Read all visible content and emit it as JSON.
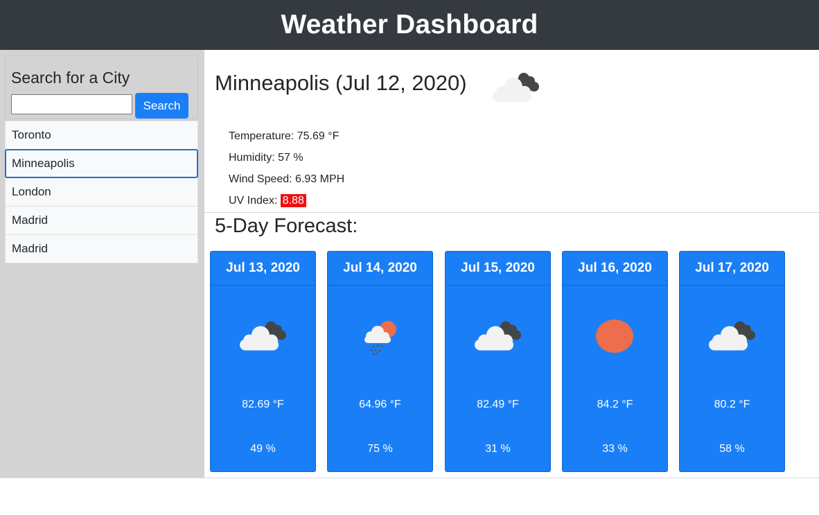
{
  "header": {
    "title": "Weather Dashboard"
  },
  "search": {
    "title": "Search for a City",
    "input_value": "",
    "button_label": "Search"
  },
  "cities": [
    "Toronto",
    "Minneapolis",
    "London",
    "Madrid",
    "Madrid"
  ],
  "current": {
    "title": "Minneapolis (Jul 12, 2020)",
    "icon": "cloudy-icon",
    "temperature": "Temperature: 75.69 °F",
    "humidity": "Humidity: 57 %",
    "wind": "Wind Speed: 6.93 MPH",
    "uv_label": "UV Index: ",
    "uv_value": "8.88",
    "uv_color": "#ee1111"
  },
  "forecast": {
    "title": "5-Day Forecast:",
    "days": [
      {
        "date": "Jul 13, 2020",
        "icon": "cloudy-icon",
        "temp": "82.69 °F",
        "humidity": "49 %"
      },
      {
        "date": "Jul 14, 2020",
        "icon": "rain-sun-icon",
        "temp": "64.96 °F",
        "humidity": "75 %"
      },
      {
        "date": "Jul 15, 2020",
        "icon": "cloudy-icon",
        "temp": "82.49 °F",
        "humidity": "31 %"
      },
      {
        "date": "Jul 16, 2020",
        "icon": "sun-icon",
        "temp": "84.2 °F",
        "humidity": "33 %"
      },
      {
        "date": "Jul 17, 2020",
        "icon": "cloudy-icon",
        "temp": "80.2 °F",
        "humidity": "58 %"
      }
    ]
  },
  "colors": {
    "navbar": "#343a40",
    "primary": "#1a7ff7",
    "sidebar": "#d3d3d3",
    "sun": "#ec6e4c"
  }
}
